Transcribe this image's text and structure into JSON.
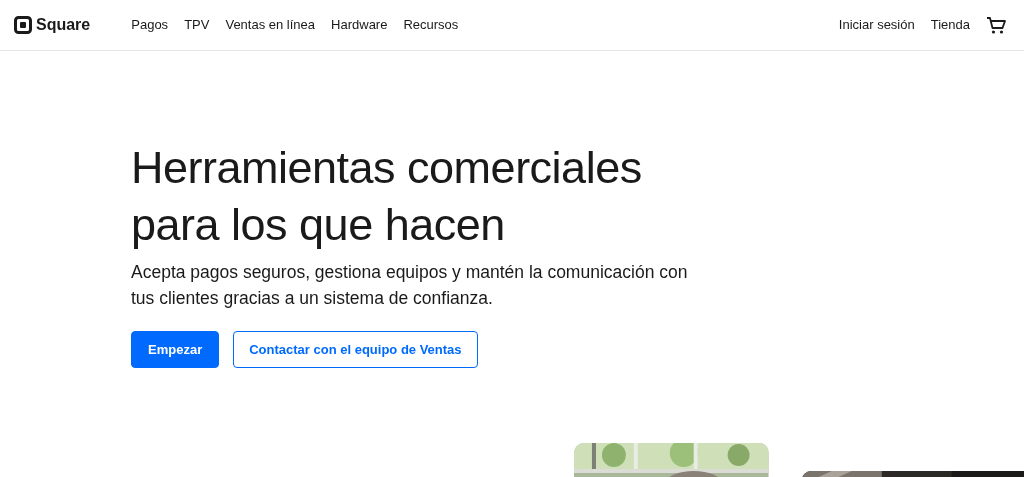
{
  "header": {
    "brand": "Square",
    "nav": [
      {
        "label": "Pagos"
      },
      {
        "label": "TPV"
      },
      {
        "label": "Ventas en línea"
      },
      {
        "label": "Hardware"
      },
      {
        "label": "Recursos"
      }
    ],
    "right_links": [
      {
        "label": "Iniciar sesión"
      },
      {
        "label": "Tienda"
      }
    ]
  },
  "hero": {
    "title": "Herramientas comerciales para los que hacen",
    "subtitle": "Acepta pagos seguros, gestiona equipos y mantén la comunicación con tus clientes gracias a un sistema de confianza.",
    "buttons": [
      {
        "label": "Empezar",
        "kind": "primary"
      },
      {
        "label": "Contactar con el equipo de Ventas",
        "kind": "outline"
      }
    ]
  }
}
